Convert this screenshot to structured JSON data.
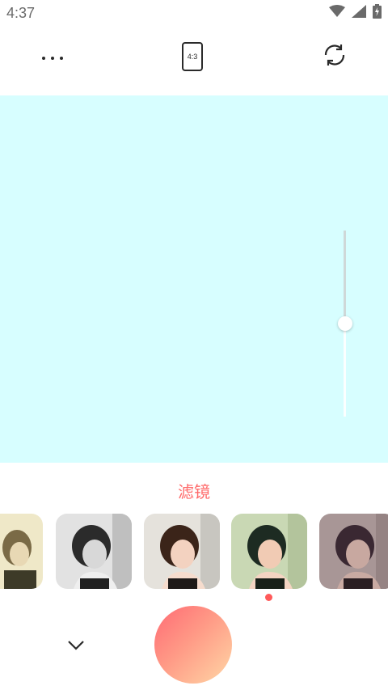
{
  "status_bar": {
    "time": "4:37",
    "icons": [
      "wifi-icon",
      "cellular-signal-icon",
      "battery-charging-icon"
    ]
  },
  "toolbar": {
    "more_icon": "more-horizontal-icon",
    "aspect_ratio_label": "4:3",
    "switch_icon": "camera-switch-icon"
  },
  "preview": {
    "background_color": "#d7feff",
    "exposure_level": 0.5
  },
  "filters": {
    "title": "滤镜",
    "selected_index": 3,
    "items": [
      {
        "tone": "warm-vintage"
      },
      {
        "tone": "monochrome"
      },
      {
        "tone": "natural"
      },
      {
        "tone": "green-fresh"
      },
      {
        "tone": "faded-purple"
      }
    ]
  },
  "controls": {
    "collapse_icon": "chevron-down-icon",
    "shutter_gradient": [
      "#ff6a74",
      "#ff9a86",
      "#ffd7a6"
    ]
  }
}
